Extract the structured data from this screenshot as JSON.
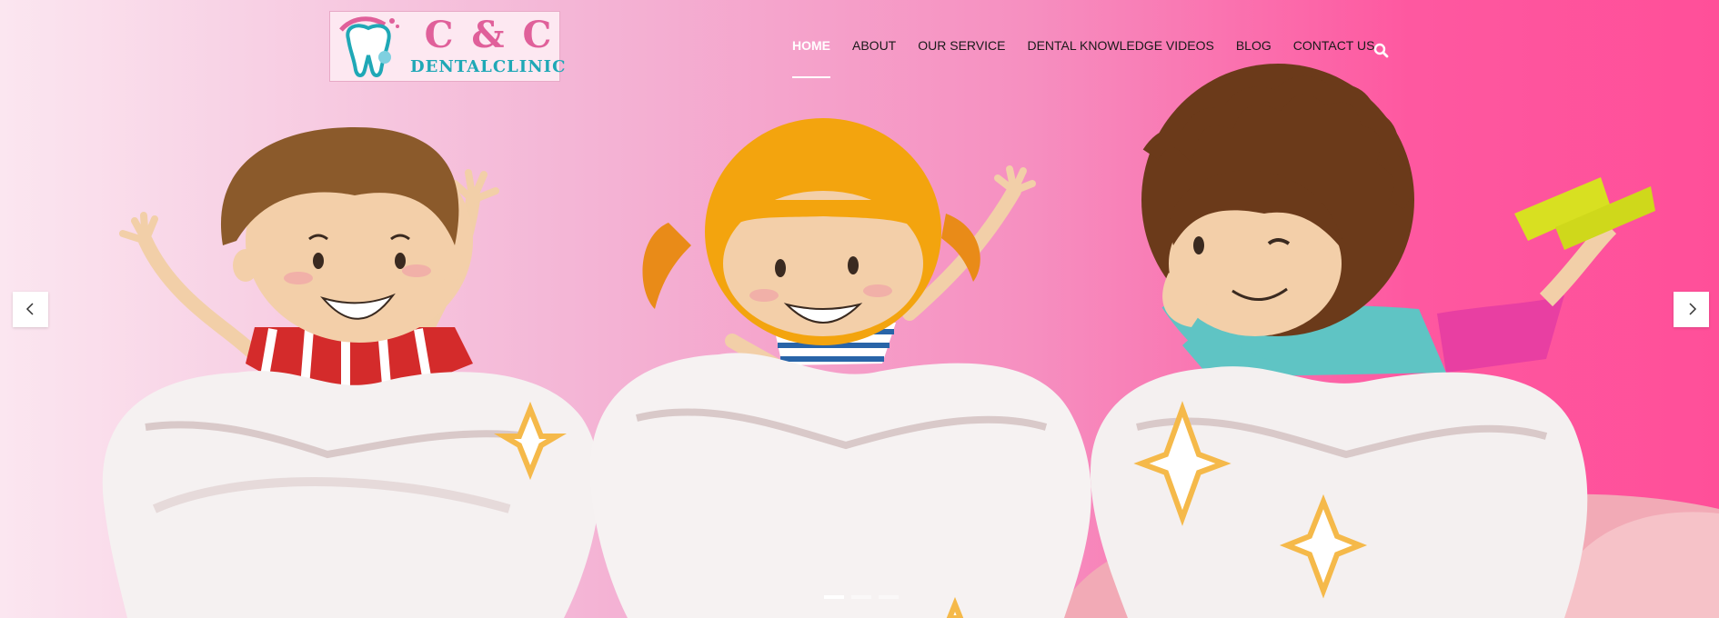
{
  "logo": {
    "title": "C & C",
    "subtitle": "DENTALCLINIC",
    "icon": "tooth-icon"
  },
  "nav": {
    "items": [
      {
        "label": "HOME",
        "active": true
      },
      {
        "label": "ABOUT",
        "active": false
      },
      {
        "label": "OUR SERVICE",
        "active": false
      },
      {
        "label": "DENTAL KNOWLEDGE VIDEOS",
        "active": false
      },
      {
        "label": "BLOG",
        "active": false
      },
      {
        "label": "CONTACT US",
        "active": false
      }
    ],
    "search_icon": "search-icon"
  },
  "slider": {
    "prev_icon": "chevron-left-icon",
    "next_icon": "chevron-right-icon",
    "slide_count": 3,
    "active_slide": 1
  },
  "colors": {
    "brand_pink": "#e0609a",
    "brand_teal": "#1fa8b6",
    "hero_pink": "#ff4f99"
  }
}
